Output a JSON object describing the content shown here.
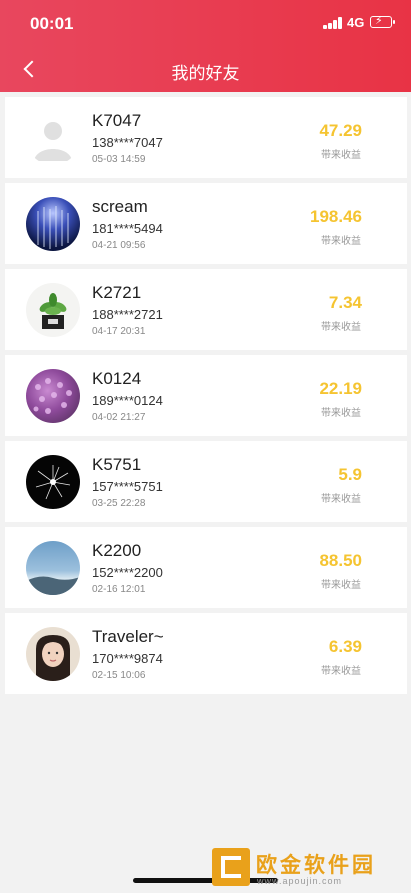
{
  "status_bar": {
    "time": "00:01",
    "network": "4G"
  },
  "nav": {
    "title": "我的好友"
  },
  "friends": [
    {
      "name": "K7047",
      "phone": "138****7047",
      "date": "05-03 14:59",
      "amount": "47.29",
      "amount_label": "带来收益",
      "avatar": "default-avatar-icon"
    },
    {
      "name": "scream",
      "phone": "181****5494",
      "date": "04-21 09:56",
      "amount": "198.46",
      "amount_label": "带来收益",
      "avatar": "night-lights-photo"
    },
    {
      "name": "K2721",
      "phone": "188****2721",
      "date": "04-17 20:31",
      "amount": "7.34",
      "amount_label": "带来收益",
      "avatar": "potted-plant-photo"
    },
    {
      "name": "K0124",
      "phone": "189****0124",
      "date": "04-02 21:27",
      "amount": "22.19",
      "amount_label": "带来收益",
      "avatar": "purple-flowers-photo"
    },
    {
      "name": "K5751",
      "phone": "157****5751",
      "date": "03-25 22:28",
      "amount": "5.9",
      "amount_label": "带来收益",
      "avatar": "firework-photo"
    },
    {
      "name": "K2200",
      "phone": "152****2200",
      "date": "02-16 12:01",
      "amount": "88.50",
      "amount_label": "带来收益",
      "avatar": "sky-photo"
    },
    {
      "name": "Traveler~",
      "phone": "170****9874",
      "date": "02-15 10:06",
      "amount": "6.39",
      "amount_label": "带来收益",
      "avatar": "girl-portrait-photo"
    }
  ],
  "watermark": {
    "text": "欧金软件园",
    "url": "www.apoujin.com"
  },
  "colors": {
    "header_start": "#e8475e",
    "header_end": "#e83345",
    "amount": "#f5c431"
  }
}
